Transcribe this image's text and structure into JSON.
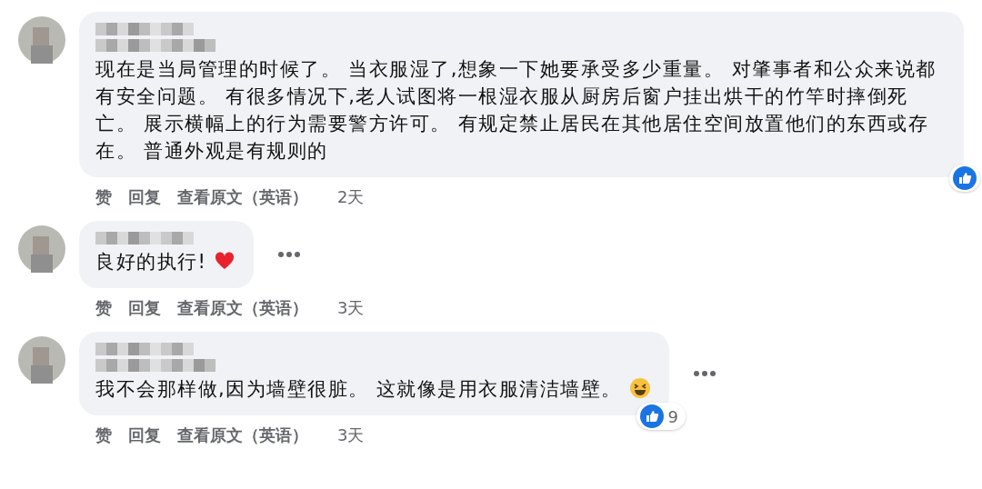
{
  "comments": [
    {
      "kind": "two_line_name",
      "text": "现在是当局管理的时候了。 当衣服湿了,想象一下她要承受多少重量。 对肇事者和公众来说都有安全问题。 有很多情况下,老人试图将一根湿衣服从厨房后窗户挂出烘干的竹竿时摔倒死亡。 展示横幅上的行为需要警方许可。 有规定禁止居民在其他居住空间放置他们的东西或存在。 普通外观是有规则的",
      "has_menu": false,
      "actions": [
        "赞",
        "回复",
        "查看原文（英语）"
      ],
      "time": "2天",
      "reaction": {
        "kind": "like"
      }
    },
    {
      "kind": "one_line_name",
      "text": "良好的执行!",
      "emoji": {
        "kind": "heart"
      },
      "has_menu": true,
      "actions": [
        "赞",
        "回复",
        "查看原文（英语）"
      ],
      "time": "3天"
    },
    {
      "kind": "two_line_name",
      "text": "我不会那样做,因为墙壁很脏。 这就像是用衣服清洁墙壁。",
      "emoji": {
        "kind": "laugh"
      },
      "has_menu": true,
      "actions": [
        "赞",
        "回复",
        "查看原文（英语）"
      ],
      "time": "3天",
      "reaction": {
        "kind": "like",
        "count": "9"
      }
    }
  ]
}
